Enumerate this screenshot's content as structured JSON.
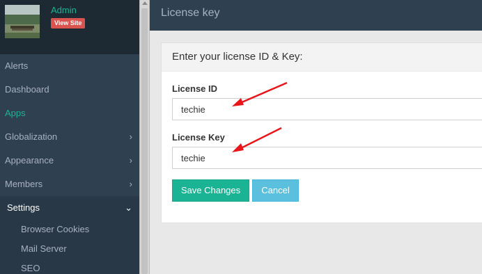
{
  "sidebar": {
    "user": {
      "name": "Admin",
      "view_site_label": "View Site"
    },
    "items": [
      {
        "label": "Alerts"
      },
      {
        "label": "Dashboard"
      },
      {
        "label": "Apps"
      },
      {
        "label": "Globalization"
      },
      {
        "label": "Appearance"
      },
      {
        "label": "Members"
      },
      {
        "label": "Settings"
      }
    ],
    "settings_sub": [
      {
        "label": "Browser Cookies"
      },
      {
        "label": "Mail Server"
      },
      {
        "label": "SEO"
      }
    ]
  },
  "header": {
    "title": "License key"
  },
  "panel": {
    "heading": "Enter your license ID & Key:",
    "license_id": {
      "label": "License ID",
      "value": "techie"
    },
    "license_key": {
      "label": "License Key",
      "value": "techie"
    },
    "save_label": "Save Changes",
    "cancel_label": "Cancel"
  },
  "colors": {
    "sidebar_bg": "#2f4050",
    "accent": "#1ab394",
    "danger": "#d9534f",
    "info": "#5bc0de",
    "annotation_arrow": "#e8161a"
  }
}
